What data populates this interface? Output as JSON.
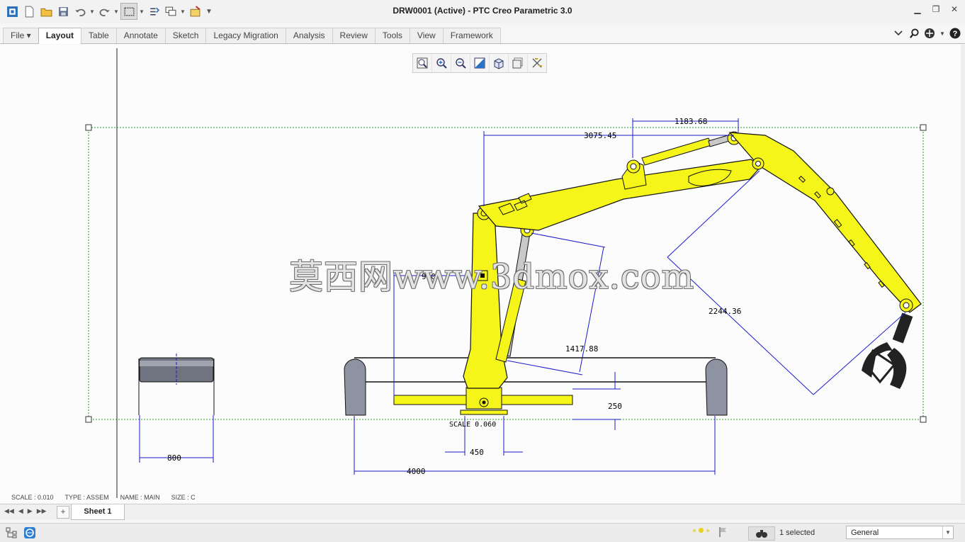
{
  "window": {
    "title": "DRW0001 (Active) - PTC Creo Parametric 3.0"
  },
  "quick_access": {
    "icons": [
      "app-icon",
      "new-icon",
      "open-icon",
      "save-icon",
      "undo-icon",
      "redo-icon",
      "select-box-icon",
      "regenerate-icon",
      "windows-icon",
      "close-window-icon",
      "customize-icon"
    ]
  },
  "ribbon": {
    "tabs": [
      {
        "label": "File ▾",
        "active": false
      },
      {
        "label": "Layout",
        "active": true
      },
      {
        "label": "Table",
        "active": false
      },
      {
        "label": "Annotate",
        "active": false
      },
      {
        "label": "Sketch",
        "active": false
      },
      {
        "label": "Legacy Migration",
        "active": false
      },
      {
        "label": "Analysis",
        "active": false
      },
      {
        "label": "Review",
        "active": false
      },
      {
        "label": "Tools",
        "active": false
      },
      {
        "label": "View",
        "active": false
      },
      {
        "label": "Framework",
        "active": false
      }
    ]
  },
  "graphics_toolbar": {
    "icons": [
      "refit-icon",
      "zoom-in-icon",
      "zoom-out-icon",
      "repaint-icon",
      "display-style-icon",
      "saved-views-icon",
      "annotation-display-icon"
    ]
  },
  "drawing": {
    "dimensions": {
      "d1183": "1183.68",
      "d3075": "3075.45",
      "d900": "900",
      "d1417": "1417.88",
      "d2244": "2244.36",
      "d250": "250",
      "d450": "450",
      "d4000": "4000",
      "d800": "800",
      "scale_note": "SCALE  0.060"
    },
    "watermark": "莫西网www.3dmox.com",
    "colors": {
      "boom_yellow": "#f5f51a",
      "outline": "#000000",
      "dimension_blue": "#1a1acc",
      "frame_green": "#2a9a2a"
    }
  },
  "info": {
    "scale": "SCALE : 0.010",
    "type": "TYPE : ASSEM",
    "name": "NAME : MAIN",
    "size": "SIZE : C"
  },
  "sheets": {
    "tabs": [
      "Sheet 1"
    ]
  },
  "status": {
    "selected": "1 selected",
    "filter": "General"
  }
}
